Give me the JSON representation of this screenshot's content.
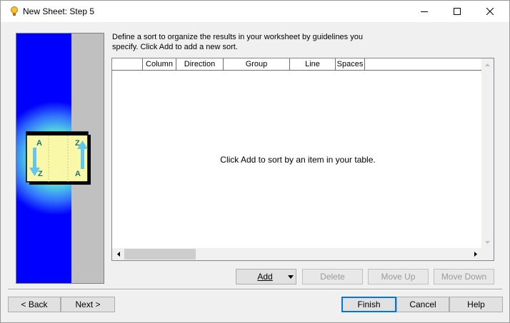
{
  "window": {
    "title": "New Sheet: Step 5",
    "minimize_icon": "minimize-icon",
    "maximize_icon": "maximize-icon",
    "close_icon": "close-icon",
    "app_icon": "lightbulb-icon"
  },
  "side_image": {
    "icon": "sort-az-wizard-image",
    "letters": [
      "A",
      "Z",
      "Z",
      "A"
    ]
  },
  "description": "Define a sort to organize the results in your worksheet by guidelines you specify. Click Add to add a new sort.",
  "grid": {
    "columns": [
      "",
      "Column",
      "Direction",
      "Group",
      "Line",
      "Spaces"
    ],
    "empty_message": "Click Add to sort by an item in your table."
  },
  "actions": {
    "add": "Add",
    "delete": "Delete",
    "move_up": "Move Up",
    "move_down": "Move Down"
  },
  "footer": {
    "back": "< Back",
    "next": "Next >",
    "finish": "Finish",
    "cancel": "Cancel",
    "help": "Help"
  },
  "colors": {
    "accent": "#0078d7",
    "side_blue": "#0000ff",
    "side_gray": "#c0c0c0"
  }
}
